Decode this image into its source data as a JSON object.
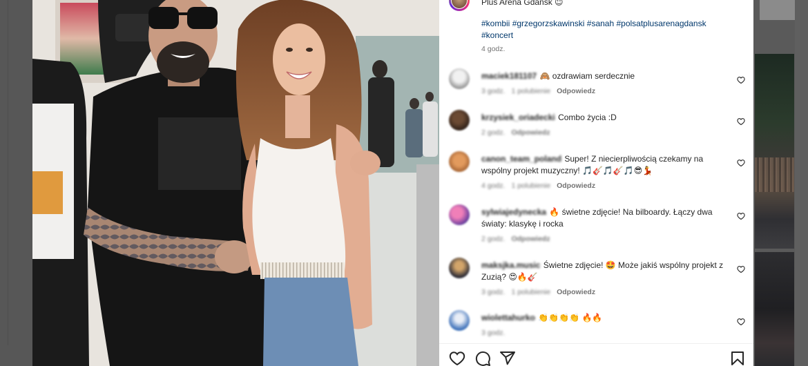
{
  "post": {
    "location": "Plus Arena Gdańsk 😇",
    "hashtags": [
      "#kombii",
      "#grzegorzskawinski",
      "#sanah",
      "#polsatplusarenagdansk",
      "#koncert"
    ],
    "time": "4 godz."
  },
  "comments": [
    {
      "username": "maciek181107",
      "text": "🙈 ozdrawiam serdecznie",
      "time": "3 godz.",
      "likes": "1 polubienie",
      "reply": "Odpowiedz"
    },
    {
      "username": "krzysiek_oriadecki",
      "text": "Combo życia :D",
      "time": "2 godz.",
      "reply": "Odpowiedz"
    },
    {
      "username": "canon_team_poland",
      "text": "Super! Z niecierpliwością czekamy na wspólny projekt muzyczny! 🎵🎸🎵🎸🎵😎💃",
      "time": "4 godz.",
      "likes": "1 polubienie",
      "reply": "Odpowiedz"
    },
    {
      "username": "sylwiajedynecka",
      "text": "🔥 świetne zdjęcie! Na bilboardy. Łączy dwa światy: klasykę i rocka",
      "time": "2 godz.",
      "reply": "Odpowiedz"
    },
    {
      "username": "maksjka.music",
      "text": "Świetne zdjęcie! 🤩 Może jakiś wspólny projekt z Zuzią? 😍🔥🎸",
      "time": "3 godz.",
      "likes": "1 polubienie",
      "reply": "Odpowiedz"
    },
    {
      "username": "wiolettahurko",
      "text": "👏👏👏👏 🔥🔥",
      "time": "3 godz."
    }
  ],
  "actions": {
    "icons": [
      "heart-icon",
      "comment-icon",
      "share-icon",
      "bookmark-icon"
    ]
  },
  "colors": {
    "text": "#262626",
    "hashtag": "#00376b",
    "meta": "#737373",
    "overlay": "#585858"
  }
}
